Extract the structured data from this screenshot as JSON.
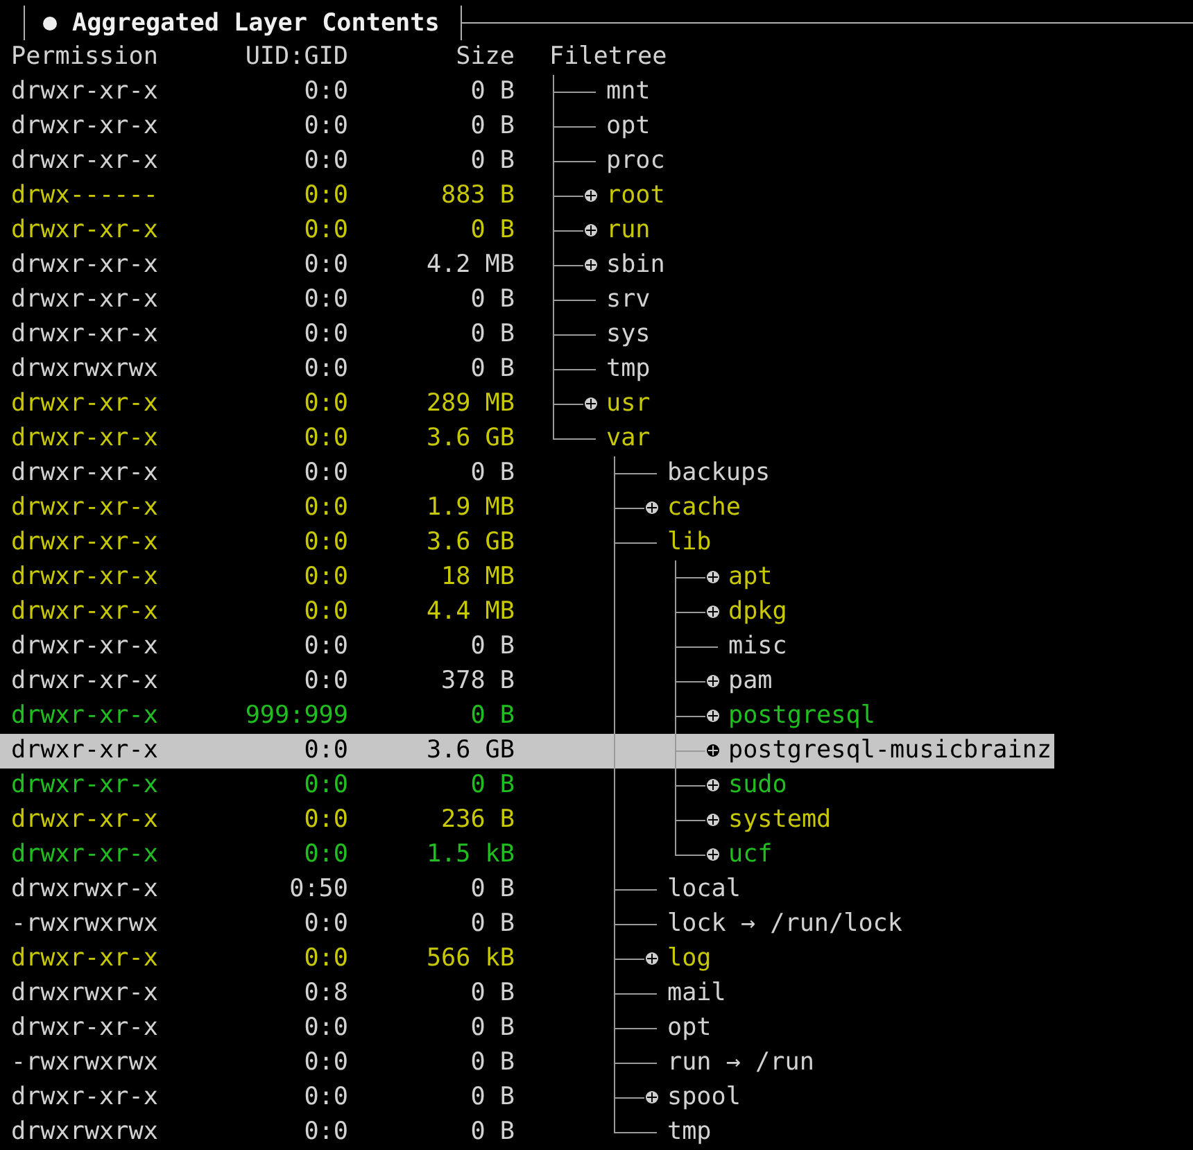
{
  "panel": {
    "title": "Aggregated Layer Contents",
    "columns": [
      "Permission",
      "UID:GID",
      "Size",
      "Filetree"
    ],
    "tree": [
      {
        "name": "mnt",
        "permission": "drwxr-xr-x",
        "owner": "0:0",
        "size": "0 B",
        "kind": "unchanged",
        "collapsed": false,
        "selected": false
      },
      {
        "name": "opt",
        "permission": "drwxr-xr-x",
        "owner": "0:0",
        "size": "0 B",
        "kind": "unchanged",
        "collapsed": false,
        "selected": false
      },
      {
        "name": "proc",
        "permission": "drwxr-xr-x",
        "owner": "0:0",
        "size": "0 B",
        "kind": "unchanged",
        "collapsed": false,
        "selected": false
      },
      {
        "name": "root",
        "permission": "drwx------",
        "owner": "0:0",
        "size": "883 B",
        "kind": "modified",
        "collapsed": true,
        "selected": false
      },
      {
        "name": "run",
        "permission": "drwxr-xr-x",
        "owner": "0:0",
        "size": "0 B",
        "kind": "modified",
        "collapsed": true,
        "selected": false
      },
      {
        "name": "sbin",
        "permission": "drwxr-xr-x",
        "owner": "0:0",
        "size": "4.2 MB",
        "kind": "unchanged",
        "collapsed": true,
        "selected": false
      },
      {
        "name": "srv",
        "permission": "drwxr-xr-x",
        "owner": "0:0",
        "size": "0 B",
        "kind": "unchanged",
        "collapsed": false,
        "selected": false
      },
      {
        "name": "sys",
        "permission": "drwxr-xr-x",
        "owner": "0:0",
        "size": "0 B",
        "kind": "unchanged",
        "collapsed": false,
        "selected": false
      },
      {
        "name": "tmp",
        "permission": "drwxrwxrwx",
        "owner": "0:0",
        "size": "0 B",
        "kind": "unchanged",
        "collapsed": false,
        "selected": false
      },
      {
        "name": "usr",
        "permission": "drwxr-xr-x",
        "owner": "0:0",
        "size": "289 MB",
        "kind": "modified",
        "collapsed": true,
        "selected": false
      },
      {
        "name": "var",
        "permission": "drwxr-xr-x",
        "owner": "0:0",
        "size": "3.6 GB",
        "kind": "modified",
        "collapsed": false,
        "selected": false,
        "children": [
          {
            "name": "backups",
            "permission": "drwxr-xr-x",
            "owner": "0:0",
            "size": "0 B",
            "kind": "unchanged",
            "collapsed": false,
            "selected": false
          },
          {
            "name": "cache",
            "permission": "drwxr-xr-x",
            "owner": "0:0",
            "size": "1.9 MB",
            "kind": "modified",
            "collapsed": true,
            "selected": false
          },
          {
            "name": "lib",
            "permission": "drwxr-xr-x",
            "owner": "0:0",
            "size": "3.6 GB",
            "kind": "modified",
            "collapsed": false,
            "selected": false,
            "children": [
              {
                "name": "apt",
                "permission": "drwxr-xr-x",
                "owner": "0:0",
                "size": "18 MB",
                "kind": "modified",
                "collapsed": true,
                "selected": false
              },
              {
                "name": "dpkg",
                "permission": "drwxr-xr-x",
                "owner": "0:0",
                "size": "4.4 MB",
                "kind": "modified",
                "collapsed": true,
                "selected": false
              },
              {
                "name": "misc",
                "permission": "drwxr-xr-x",
                "owner": "0:0",
                "size": "0 B",
                "kind": "unchanged",
                "collapsed": false,
                "selected": false
              },
              {
                "name": "pam",
                "permission": "drwxr-xr-x",
                "owner": "0:0",
                "size": "378 B",
                "kind": "unchanged",
                "collapsed": true,
                "selected": false
              },
              {
                "name": "postgresql",
                "permission": "drwxr-xr-x",
                "owner": "999:999",
                "size": "0 B",
                "kind": "added",
                "collapsed": true,
                "selected": false
              },
              {
                "name": "postgresql-musicbrainz",
                "permission": "drwxr-xr-x",
                "owner": "0:0",
                "size": "3.6 GB",
                "kind": "unchanged",
                "collapsed": true,
                "selected": true
              },
              {
                "name": "sudo",
                "permission": "drwxr-xr-x",
                "owner": "0:0",
                "size": "0 B",
                "kind": "added",
                "collapsed": true,
                "selected": false
              },
              {
                "name": "systemd",
                "permission": "drwxr-xr-x",
                "owner": "0:0",
                "size": "236 B",
                "kind": "modified",
                "collapsed": true,
                "selected": false
              },
              {
                "name": "ucf",
                "permission": "drwxr-xr-x",
                "owner": "0:0",
                "size": "1.5 kB",
                "kind": "added",
                "collapsed": true,
                "selected": false
              }
            ]
          },
          {
            "name": "local",
            "permission": "drwxrwxr-x",
            "owner": "0:50",
            "size": "0 B",
            "kind": "unchanged",
            "collapsed": false,
            "selected": false
          },
          {
            "name": "lock → /run/lock",
            "permission": "-rwxrwxrwx",
            "owner": "0:0",
            "size": "0 B",
            "kind": "unchanged",
            "collapsed": false,
            "selected": false
          },
          {
            "name": "log",
            "permission": "drwxr-xr-x",
            "owner": "0:0",
            "size": "566 kB",
            "kind": "modified",
            "collapsed": true,
            "selected": false
          },
          {
            "name": "mail",
            "permission": "drwxrwxr-x",
            "owner": "0:8",
            "size": "0 B",
            "kind": "unchanged",
            "collapsed": false,
            "selected": false
          },
          {
            "name": "opt",
            "permission": "drwxr-xr-x",
            "owner": "0:0",
            "size": "0 B",
            "kind": "unchanged",
            "collapsed": false,
            "selected": false
          },
          {
            "name": "run → /run",
            "permission": "-rwxrwxrwx",
            "owner": "0:0",
            "size": "0 B",
            "kind": "unchanged",
            "collapsed": false,
            "selected": false
          },
          {
            "name": "spool",
            "permission": "drwxr-xr-x",
            "owner": "0:0",
            "size": "0 B",
            "kind": "unchanged",
            "collapsed": true,
            "selected": false
          },
          {
            "name": "tmp",
            "permission": "drwxrwxrwx",
            "owner": "0:0",
            "size": "0 B",
            "kind": "unchanged",
            "collapsed": false,
            "selected": false
          }
        ]
      }
    ]
  }
}
